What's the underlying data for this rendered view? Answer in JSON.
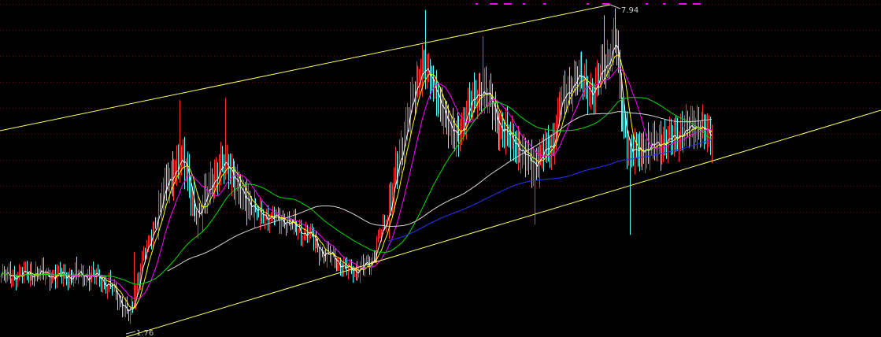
{
  "chart_data": {
    "type": "candlestick",
    "grid": true,
    "ylim": [
      1.5,
      8.1
    ],
    "high_label": "7.94",
    "low_label": "1.76",
    "extreme_high": 7.94,
    "extreme_low": 1.76,
    "colors": {
      "background": "#000000",
      "grid": "#7a0000",
      "up": "#ff3232",
      "down": "#54ffff",
      "channel": "#ffff66",
      "ma_short": "#ffffff",
      "ma_mid": "#ffff00",
      "ma_20": "#ff00ff",
      "ma_60": "#00dd00",
      "ma_120": "#d8d8d8",
      "ma_250": "#2a33ff",
      "top_marks": "#ff00ff"
    },
    "close_anchors": [
      [
        0,
        2.68
      ],
      [
        20,
        2.74
      ],
      [
        40,
        2.7
      ],
      [
        60,
        2.7
      ],
      [
        70,
        2.55
      ],
      [
        80,
        2.15
      ],
      [
        85,
        1.95
      ],
      [
        95,
        3.2
      ],
      [
        110,
        4.5
      ],
      [
        118,
        5.0
      ],
      [
        130,
        3.9
      ],
      [
        140,
        4.6
      ],
      [
        148,
        4.9
      ],
      [
        160,
        4.25
      ],
      [
        170,
        3.9
      ],
      [
        185,
        3.8
      ],
      [
        200,
        3.55
      ],
      [
        215,
        3.1
      ],
      [
        230,
        2.8
      ],
      [
        242,
        2.9
      ],
      [
        252,
        3.6
      ],
      [
        262,
        4.9
      ],
      [
        272,
        6.3
      ],
      [
        280,
        6.8
      ],
      [
        290,
        6.0
      ],
      [
        300,
        5.4
      ],
      [
        310,
        6.1
      ],
      [
        318,
        6.35
      ],
      [
        330,
        5.6
      ],
      [
        338,
        5.3
      ],
      [
        350,
        4.9
      ],
      [
        362,
        5.2
      ],
      [
        370,
        6.15
      ],
      [
        380,
        6.6
      ],
      [
        390,
        6.3
      ],
      [
        398,
        6.8
      ],
      [
        405,
        7.3
      ],
      [
        410,
        5.8
      ],
      [
        415,
        5.1
      ],
      [
        425,
        5.2
      ],
      [
        440,
        5.35
      ],
      [
        452,
        5.55
      ],
      [
        460,
        5.65
      ],
      [
        468,
        5.4
      ]
    ]
  }
}
